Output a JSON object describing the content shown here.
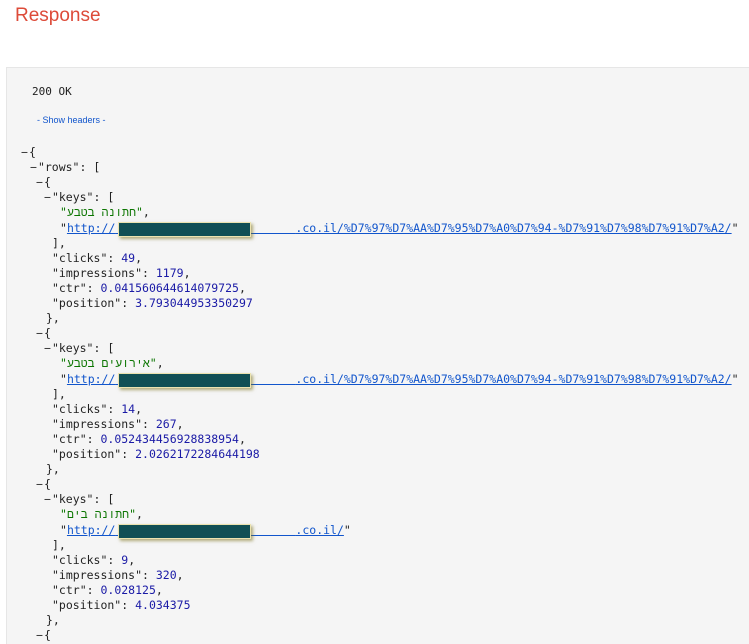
{
  "header": {
    "title": "Response"
  },
  "response": {
    "status": "200 OK",
    "show_headers_label": "- Show headers -"
  },
  "json_view": {
    "open_brace": "{",
    "rows_key": "\"rows\"",
    "open_bracket": "[",
    "toggle_symbol": "−",
    "keys_key": "\"keys\"",
    "clicks_key": "\"clicks\"",
    "impressions_key": "\"impressions\"",
    "ctr_key": "\"ctr\"",
    "position_key": "\"position\"",
    "rows": [
      {
        "query": "\"חתונה בטבע\"",
        "url_prefix": "http://",
        "url_suffix": ".co.il/%D7%97%D7%AA%D7%95%D7%A0%D7%94-%D7%91%D7%98%D7%91%D7%A2/",
        "clicks": "49",
        "impressions": "1179",
        "ctr": "0.041560644614079725",
        "position": "3.793044953350297"
      },
      {
        "query": "\"אירועים בטבע\"",
        "url_prefix": "http://",
        "url_suffix": ".co.il/%D7%97%D7%AA%D7%95%D7%A0%D7%94-%D7%91%D7%98%D7%91%D7%A2/",
        "clicks": "14",
        "impressions": "267",
        "ctr": "0.052434456928838954",
        "position": "2.0262172284644198"
      },
      {
        "query": "\"חתונה בים\"",
        "url_prefix": "http://",
        "url_suffix": ".co.il/",
        "clicks": "9",
        "impressions": "320",
        "ctr": "0.028125",
        "position": "4.034375"
      }
    ]
  }
}
